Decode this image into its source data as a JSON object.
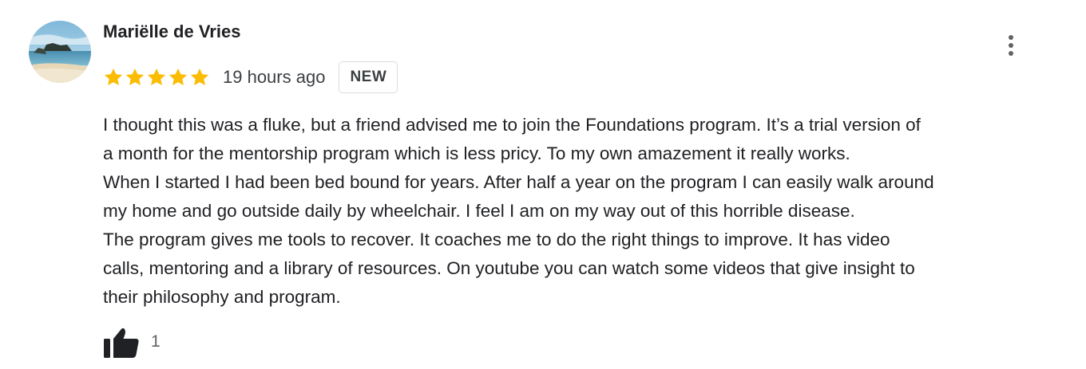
{
  "review": {
    "author_name": "Mariëlle de Vries",
    "rating": 5,
    "rating_max": 5,
    "time_ago": "19 hours ago",
    "badge": "NEW",
    "star_color": "#fbbc04",
    "text_lines": [
      "I thought this was a fluke, but a friend advised me to join the Foundations program. It’s a trial version of",
      "a month for the mentorship program which is less pricy. To my own amazement it really works.",
      "When I started I had been bed bound for years. After half a year on the program I can easily walk around",
      "my home and go outside daily by wheelchair. I feel I am on my way out of this horrible disease.",
      "The program gives me tools to recover. It coaches me to do the right things to improve. It has video",
      "calls, mentoring and a library of resources. On youtube you can watch some videos that give insight to",
      "their philosophy and program."
    ],
    "like_count": "1"
  },
  "icons": {
    "avatar": "profile-photo-beach",
    "menu": "more-vert-icon",
    "like": "thumb-up-icon",
    "star": "star-icon"
  }
}
